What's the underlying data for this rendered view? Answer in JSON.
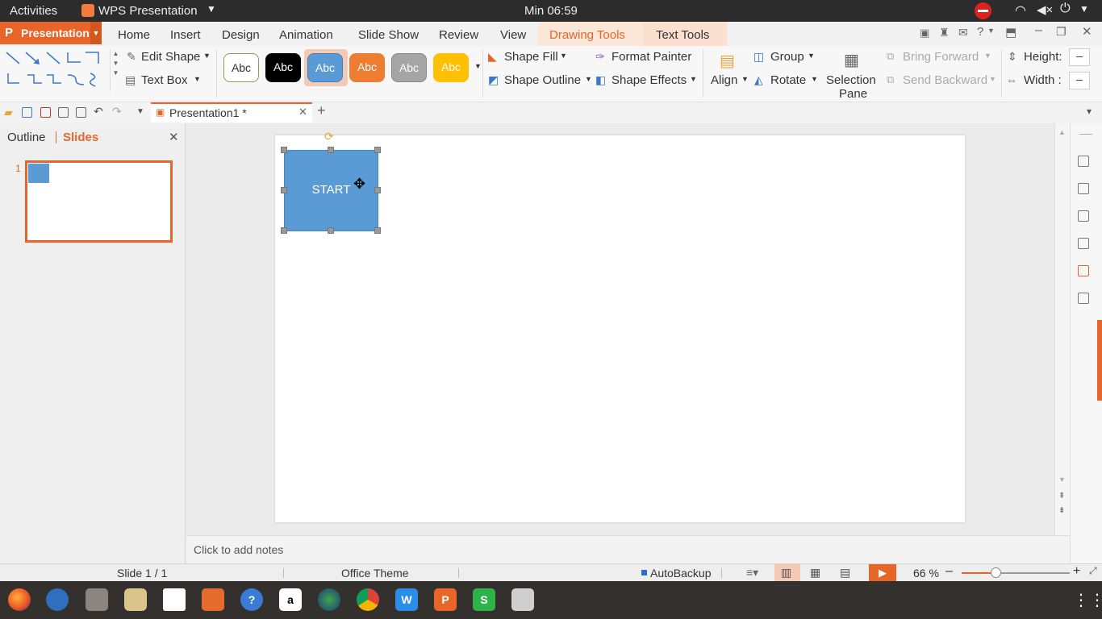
{
  "topbar": {
    "activities": "Activities",
    "app_name": "WPS Presentation",
    "clock": "Min 06:59"
  },
  "menubar": {
    "presentation_btn": "Presentation",
    "tabs": [
      "Home",
      "Insert",
      "Design",
      "Animation",
      "Slide Show",
      "Review",
      "View",
      "Drawing Tools",
      "Text Tools"
    ]
  },
  "ribbon": {
    "edit_shape": "Edit Shape",
    "text_box": "Text Box",
    "style_samples": [
      "Abc",
      "Abc",
      "Abc",
      "Abc",
      "Abc",
      "Abc"
    ],
    "shape_fill": "Shape Fill",
    "shape_outline": "Shape Outline",
    "format_painter": "Format Painter",
    "shape_effects": "Shape Effects",
    "align": "Align",
    "group": "Group",
    "rotate": "Rotate",
    "selection_pane_1": "Selection",
    "selection_pane_2": "Pane",
    "bring_forward": "Bring Forward",
    "send_backward": "Send Backward",
    "height_label": "Height:",
    "width_label": "Width :",
    "height_value": "–",
    "width_value": "–"
  },
  "quickbar": {
    "doc_tab": "Presentation1 *",
    "add_tab": "+"
  },
  "leftpane": {
    "tab_outline": "Outline",
    "tab_slides": "Slides",
    "slide_number": "1"
  },
  "slide": {
    "shape_text": "START"
  },
  "notes": {
    "placeholder": "Click to add notes"
  },
  "status": {
    "slide_info": "Slide 1 / 1",
    "theme": "Office Theme",
    "autobackup": "AutoBackup",
    "zoom": "66 %",
    "zoom_level": 0.66
  },
  "colors": {
    "accent": "#e8652a",
    "shape_fill": "#5b9bd5",
    "topbar": "#2c2c2c",
    "dock": "#34302d"
  }
}
